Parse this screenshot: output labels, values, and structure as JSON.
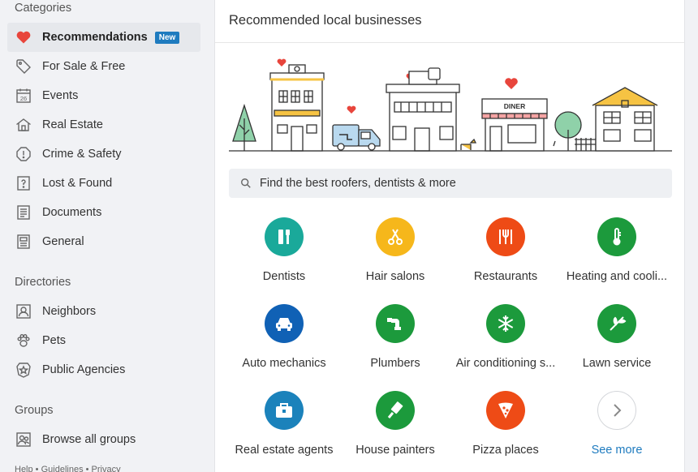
{
  "sidebar": {
    "categories_title": "Categories",
    "categories": [
      {
        "label": "Recommendations",
        "icon": "heart-icon",
        "badge": "New",
        "active": true
      },
      {
        "label": "For Sale & Free",
        "icon": "tag-icon"
      },
      {
        "label": "Events",
        "icon": "calendar-icon",
        "calendar_day": "26"
      },
      {
        "label": "Real Estate",
        "icon": "house-icon"
      },
      {
        "label": "Crime & Safety",
        "icon": "alert-icon"
      },
      {
        "label": "Lost & Found",
        "icon": "question-icon"
      },
      {
        "label": "Documents",
        "icon": "document-icon"
      },
      {
        "label": "General",
        "icon": "newspaper-icon"
      }
    ],
    "directories_title": "Directories",
    "directories": [
      {
        "label": "Neighbors",
        "icon": "person-icon"
      },
      {
        "label": "Pets",
        "icon": "paw-icon"
      },
      {
        "label": "Public Agencies",
        "icon": "badge-icon"
      }
    ],
    "groups_title": "Groups",
    "groups": [
      {
        "label": "Browse all groups",
        "icon": "group-icon"
      }
    ],
    "footer": "Help • Guidelines • Privacy"
  },
  "main": {
    "title": "Recommended local businesses",
    "illustration_sign": "DINER",
    "search": {
      "placeholder": "Find the best roofers, dentists & more"
    },
    "categories": [
      {
        "label": "Dentists",
        "icon": "dentist-icon",
        "color": "#1aa99a"
      },
      {
        "label": "Hair salons",
        "icon": "scissors-icon",
        "color": "#f6b71b"
      },
      {
        "label": "Restaurants",
        "icon": "fork-knife-icon",
        "color": "#ee4b16"
      },
      {
        "label": "Heating and cooli...",
        "icon": "thermometer-icon",
        "color": "#1c9a3c"
      },
      {
        "label": "Auto mechanics",
        "icon": "car-icon",
        "color": "#1061b5"
      },
      {
        "label": "Plumbers",
        "icon": "pipe-icon",
        "color": "#1c9a3c"
      },
      {
        "label": "Air conditioning s...",
        "icon": "snowflake-icon",
        "color": "#1c9a3c"
      },
      {
        "label": "Lawn service",
        "icon": "lawn-icon",
        "color": "#1c9a3c"
      },
      {
        "label": "Real estate agents",
        "icon": "briefcase-icon",
        "color": "#1b82bb"
      },
      {
        "label": "House painters",
        "icon": "paint-roller-icon",
        "color": "#1c9a3c"
      },
      {
        "label": "Pizza places",
        "icon": "pizza-icon",
        "color": "#ee4b16"
      },
      {
        "label": "See more",
        "icon": "chevron-right-icon",
        "color": "#ffffff"
      }
    ]
  }
}
